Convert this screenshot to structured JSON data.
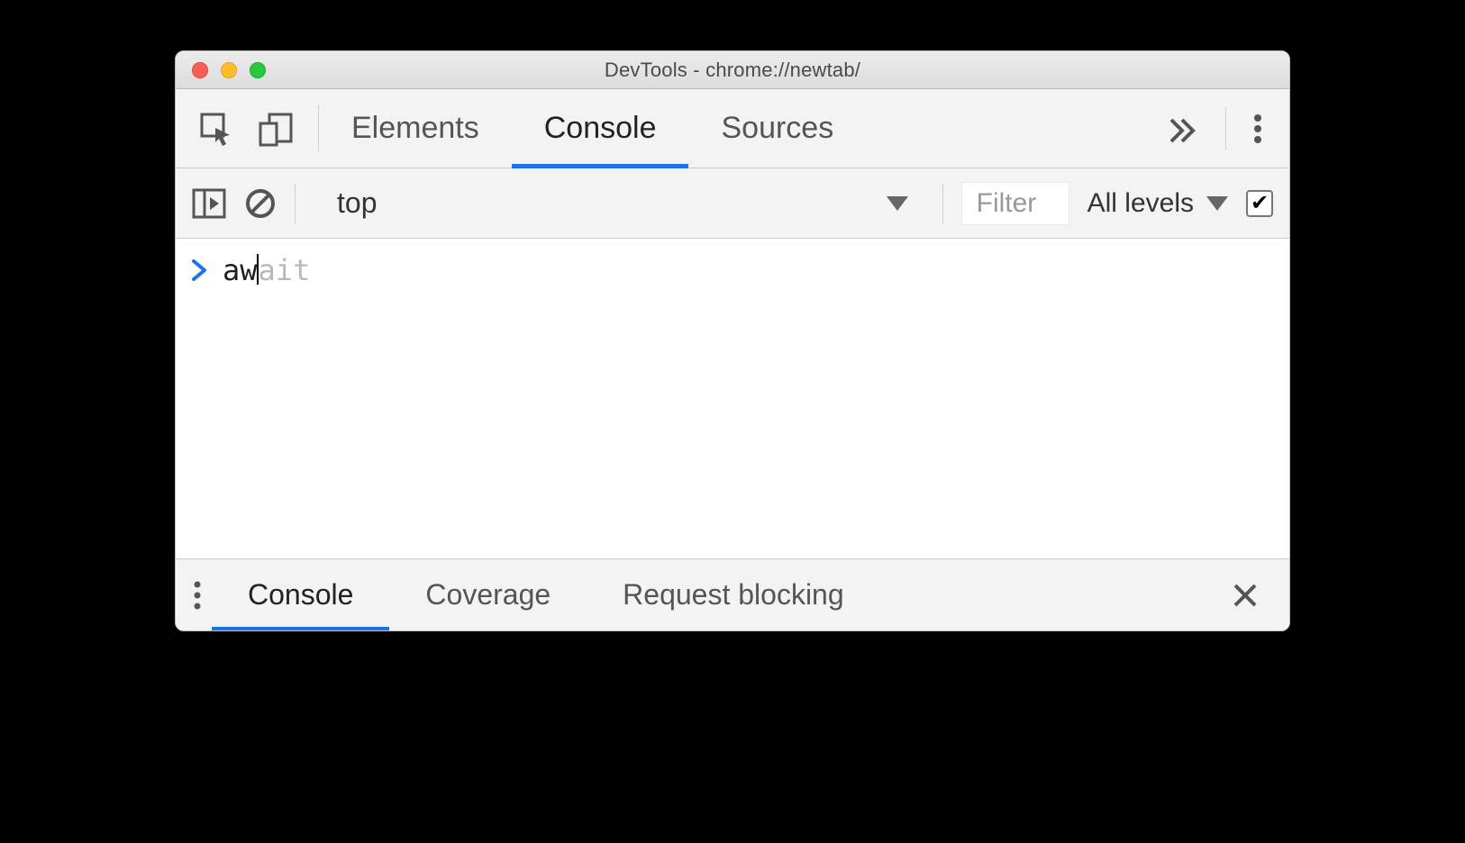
{
  "window": {
    "title": "DevTools - chrome://newtab/"
  },
  "tabs": {
    "elements": "Elements",
    "console": "Console",
    "sources": "Sources",
    "active": "Console"
  },
  "toolbar": {
    "context": "top",
    "filter_placeholder": "Filter",
    "levels_label": "All levels",
    "group_similar_checked": true
  },
  "console": {
    "typed": "aw",
    "autocomplete_suffix": "ait"
  },
  "drawer": {
    "tabs": {
      "console": "Console",
      "coverage": "Coverage",
      "request_blocking": "Request blocking",
      "active": "Console"
    }
  }
}
